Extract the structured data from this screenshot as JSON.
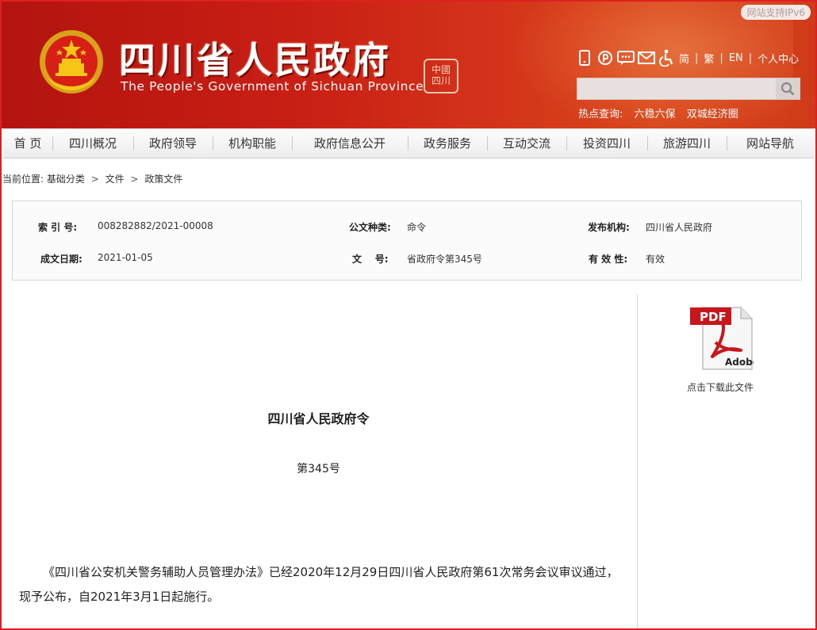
{
  "header": {
    "title": "四川省人民政府",
    "subtitle": "The People's Government of Sichuan Province",
    "seal_text": [
      "中",
      "國",
      "四",
      "川"
    ],
    "ipv6": "网站支持IPv6",
    "lang_simplified": "简",
    "lang_traditional": "繁",
    "lang_english": "EN",
    "personal_center": "个人中心",
    "search": {
      "value": "",
      "placeholder": ""
    },
    "hot_label": "热点查询:",
    "hot_items": [
      "六稳六保",
      "双城经济圈"
    ]
  },
  "nav": {
    "items": [
      "首 页",
      "四川概况",
      "政府领导",
      "机构职能",
      "政府信息公开",
      "政务服务",
      "互动交流",
      "投资四川",
      "旅游四川",
      "网站导航"
    ]
  },
  "breadcrumb": {
    "label": "当前位置:",
    "items": [
      "基础分类",
      "文件",
      "政策文件"
    ],
    "separator": ">"
  },
  "info": {
    "index_label": "索 引 号:",
    "index_value": "008282882/2021-00008",
    "category_label": "公文种类:",
    "category_value": "命令",
    "issuer_label": "发布机构:",
    "issuer_value": "四川省人民政府",
    "date_label": "成文日期:",
    "date_value": "2021-01-05",
    "docno_label": "文    号:",
    "docno_value": "省政府令第345号",
    "validity_label": "有 效 性:",
    "validity_value": "有效"
  },
  "download": {
    "icon_text_top": "PDF",
    "icon_text_bottom": "Adobe",
    "caption": "点击下载此文件"
  },
  "document": {
    "title": "四川省人民政府令",
    "number": "第345号",
    "body": "《四川省公安机关警务辅助人员管理办法》已经2020年12月29日四川省人民政府第61次常务会议审议通过，现予公布，自2021年3月1日起施行。"
  },
  "colors": {
    "header_red": "#c81e14",
    "frame_red": "#e02020",
    "pdf_red": "#c8161d"
  }
}
